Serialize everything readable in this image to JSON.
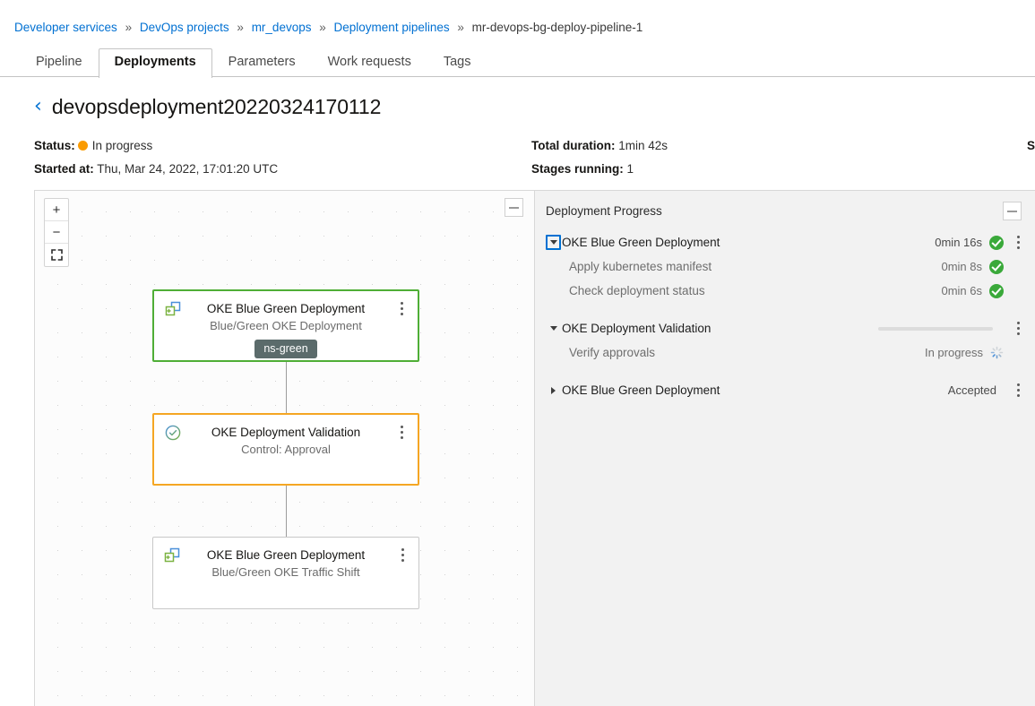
{
  "breadcrumb": {
    "separator": "»",
    "items": [
      {
        "label": "Developer services",
        "link": true
      },
      {
        "label": "DevOps projects",
        "link": true
      },
      {
        "label": "mr_devops",
        "link": true
      },
      {
        "label": "Deployment pipelines",
        "link": true
      },
      {
        "label": "mr-devops-bg-deploy-pipeline-1",
        "link": false
      }
    ]
  },
  "tabs": [
    {
      "label": "Pipeline",
      "active": false
    },
    {
      "label": "Deployments",
      "active": true
    },
    {
      "label": "Parameters",
      "active": false
    },
    {
      "label": "Work requests",
      "active": false
    },
    {
      "label": "Tags",
      "active": false
    }
  ],
  "header": {
    "back_icon": "chevron-left-icon",
    "title": "devopsdeployment20220324170112",
    "meta": {
      "status_label": "Status:",
      "status_value": "In progress",
      "status_color": "#fa9b00",
      "started_label": "Started at:",
      "started_value": "Thu, Mar 24, 2022, 17:01:20 UTC",
      "duration_label": "Total duration:",
      "duration_value": "1min 42s",
      "stages_label": "Stages running:",
      "stages_value": "1",
      "clipped_label": "S"
    }
  },
  "canvas": {
    "zoom_in": "+",
    "zoom_out": "−",
    "fit_icon": "fit-to-screen-icon",
    "collapse_icon": "minimize-icon",
    "nodes": [
      {
        "title": "OKE Blue Green Deployment",
        "subtitle": "Blue/Green OKE Deployment",
        "badge": "ns-green",
        "state": "state-success",
        "icon": "deploy-stage-icon"
      },
      {
        "title": "OKE Deployment Validation",
        "subtitle": "Control: Approval",
        "badge": "",
        "state": "state-pending",
        "icon": "approval-check-icon"
      },
      {
        "title": "OKE Blue Green Deployment",
        "subtitle": "Blue/Green OKE Traffic Shift",
        "badge": "",
        "state": "",
        "icon": "deploy-stage-icon"
      }
    ]
  },
  "progress_panel": {
    "title": "Deployment Progress",
    "collapse_icon": "minimize-icon",
    "rows": [
      {
        "label": "OKE Blue Green Deployment",
        "duration": "0min 16s",
        "status_icon": "success-check-icon",
        "level": "group",
        "expanded": true,
        "focused": true,
        "has_menu": true
      },
      {
        "label": "Apply kubernetes manifest",
        "duration": "0min 8s",
        "status_icon": "success-check-icon",
        "level": "sub",
        "has_menu": false
      },
      {
        "label": "Check deployment status",
        "duration": "0min 6s",
        "status_icon": "success-check-icon",
        "level": "sub",
        "has_menu": false
      },
      {
        "label": "OKE Deployment Validation",
        "duration": "",
        "status_icon": "progress-bar",
        "level": "group",
        "expanded": true,
        "focused": false,
        "has_menu": true
      },
      {
        "label": "Verify approvals",
        "duration": "In progress",
        "status_icon": "spinner-icon",
        "level": "sub",
        "has_menu": false
      },
      {
        "label": "OKE Blue Green Deployment",
        "duration": "Accepted",
        "status_icon": "none",
        "level": "group",
        "expanded": false,
        "focused": false,
        "has_menu": true
      }
    ]
  }
}
